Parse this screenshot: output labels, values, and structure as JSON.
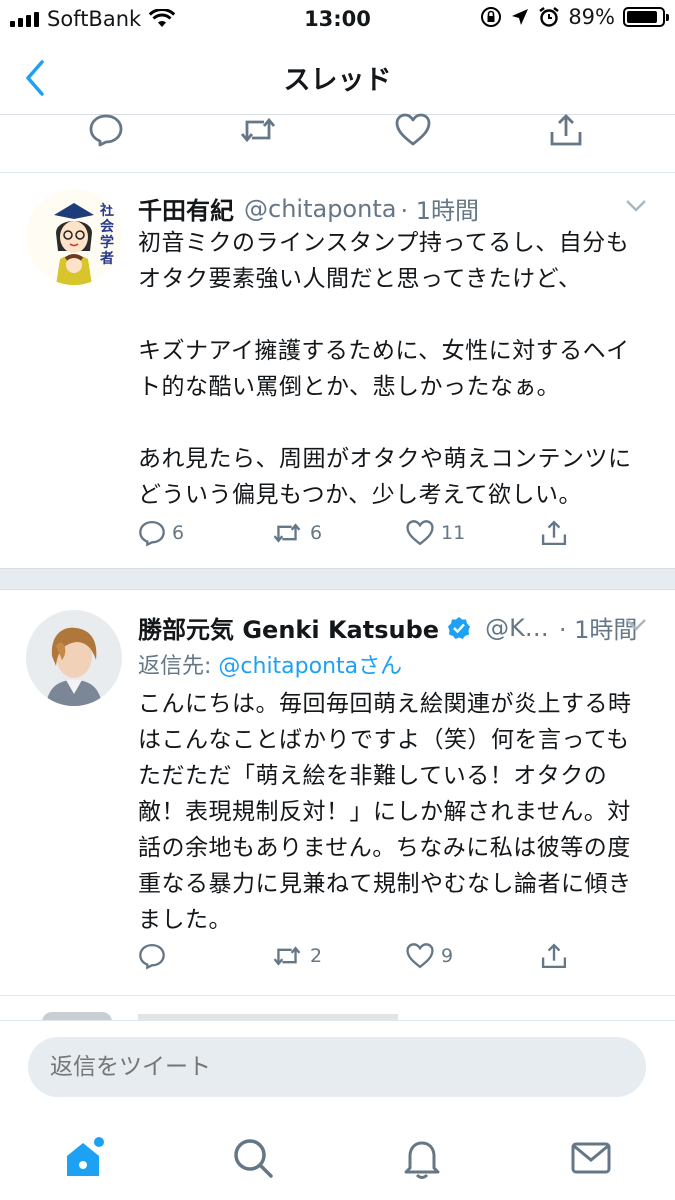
{
  "status_bar": {
    "carrier": "SoftBank",
    "time": "13:00",
    "battery_percent": "89%",
    "battery_level": 0.89
  },
  "nav": {
    "title": "スレッド",
    "back_icon": "chevron-left-icon"
  },
  "colors": {
    "accent": "#1da1f2",
    "secondary_text": "#657786",
    "divider": "#e1e8ed",
    "composer_bg": "#e6ecf0"
  },
  "top_actions": {
    "icons": [
      "reply-icon",
      "retweet-icon",
      "like-icon",
      "share-icon"
    ]
  },
  "tweets": [
    {
      "name": "千田有紀",
      "handle": "@chitaponta",
      "time": "· 1時間",
      "avatar_text": "社会学者",
      "body": "初音ミクのラインスタンプ持ってるし、自分もオタク要素強い人間だと思ってきたけど、\n\nキズナアイ擁護するために、女性に対するヘイト的な酷い罵倒とか、悲しかったなぁ。\n\nあれ見たら、周囲がオタクや萌えコンテンツにどういう偏見もつか、少し考えて欲しい。",
      "reply_count": "6",
      "retweet_count": "6",
      "like_count": "11"
    },
    {
      "name": "勝部元気 Genki Katsube",
      "handle": "@K…",
      "time": "· 1時間",
      "reply_to_label": "返信先: ",
      "reply_to_link": "@chitapontaさん",
      "body": "こんにちは。毎回毎回萌え絵関連が炎上する時はこんなことばかりですよ（笑）何を言ってもただただ「萌え絵を非難している！オタクの敵！表現規制反対！」にしか解されません。対話の余地もありません。ちなみに私は彼等の度重なる暴力に見兼ねて規制やむなし論者に傾きました。",
      "reply_count": "",
      "retweet_count": "2",
      "like_count": "9"
    }
  ],
  "composer": {
    "placeholder": "返信をツイート"
  },
  "tabbar": {
    "icons": [
      "home-icon",
      "search-icon",
      "notifications-icon",
      "messages-icon"
    ]
  }
}
